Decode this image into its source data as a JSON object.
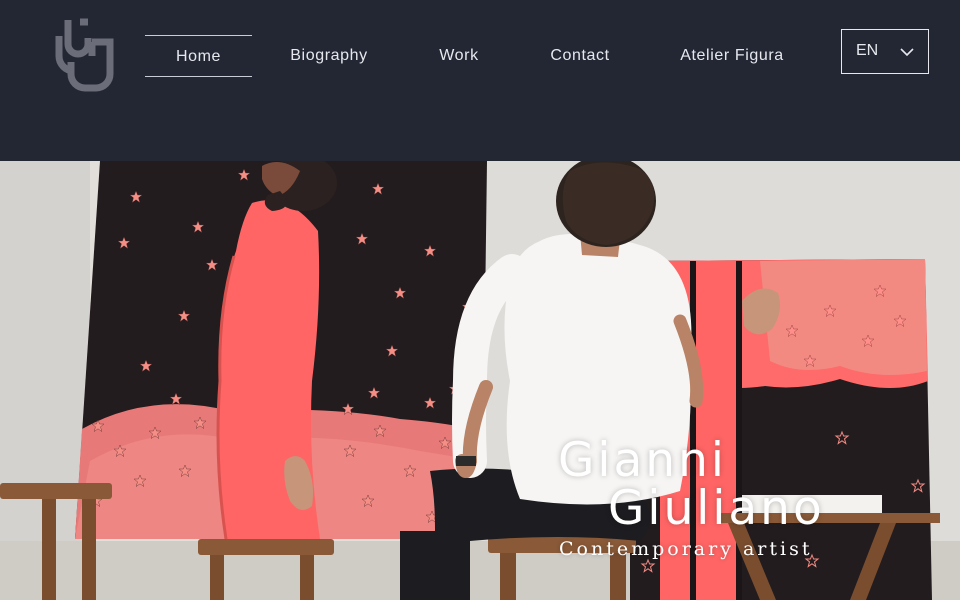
{
  "logo": {
    "icon": "monogram-logo-icon",
    "color": "#6b6e79"
  },
  "nav": {
    "items": [
      {
        "label": "Home",
        "active": true
      },
      {
        "label": "Biography"
      },
      {
        "label": "Work"
      },
      {
        "label": "Contact"
      },
      {
        "label": "Atelier Figura"
      }
    ]
  },
  "language": {
    "selected": "EN",
    "icon": "chevron-down-icon"
  },
  "hero": {
    "title_line1": "Gianni",
    "title_line2": "Giuliano",
    "subtitle": "Contemporary artist",
    "image": "artist-painting-in-studio"
  },
  "colors": {
    "header_bg": "#232733",
    "text": "#e6e8ee",
    "painting_dark": "#231c1e",
    "painting_pink": "#ff6b6b"
  }
}
